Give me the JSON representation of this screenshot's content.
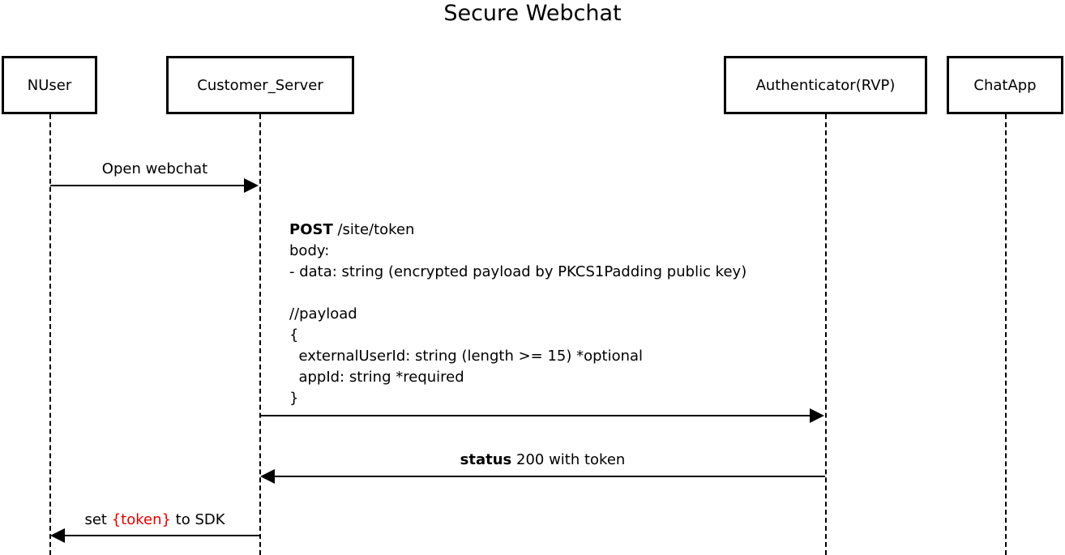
{
  "diagram": {
    "title": "Secure Webchat",
    "actors": [
      {
        "name": "NUser"
      },
      {
        "name": "Customer_Server"
      },
      {
        "name": "Authenticator(RVP)"
      },
      {
        "name": "ChatApp"
      }
    ],
    "messages": {
      "open_webchat": {
        "label": "Open webchat"
      },
      "post_token": {
        "method": "POST",
        "path": " /site/token",
        "lines": [
          "body:",
          "- data: string (encrypted payload by PKCS1Padding public key)",
          "",
          "//payload",
          "{",
          "  externalUserId: string (length >= 15) *optional",
          "  appId: string *required",
          "}"
        ]
      },
      "status_response": {
        "status_word": "status",
        "rest": " 200 with token"
      },
      "set_token": {
        "prefix": "set ",
        "token": "{token}",
        "suffix": " to SDK"
      }
    },
    "colors": {
      "line": "#000000",
      "token_highlight": "#e00000"
    }
  }
}
